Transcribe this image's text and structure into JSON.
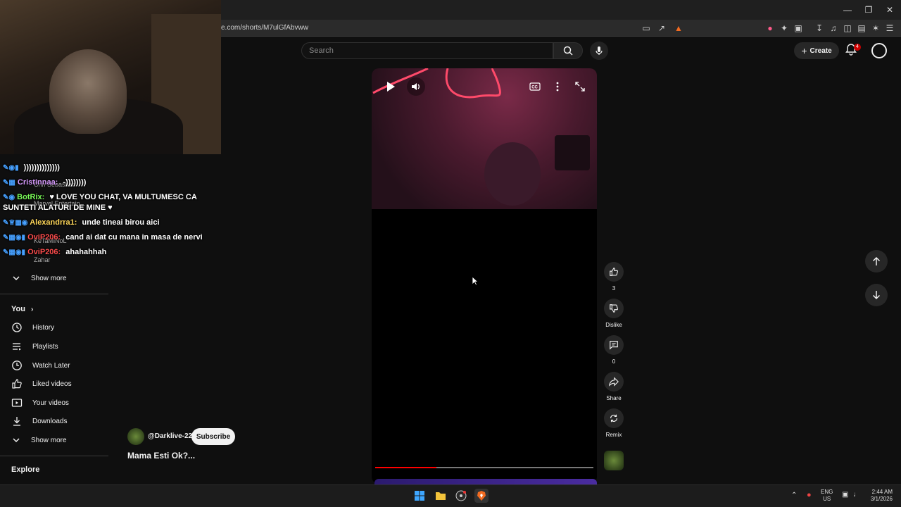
{
  "browser": {
    "url": "e.com/shorts/M7ulGfAbvww"
  },
  "header": {
    "search_placeholder": "Search",
    "create_label": "Create",
    "notification_count": "4"
  },
  "chat": [
    {
      "user": "",
      "message": "))))))))))))))"
    },
    {
      "user": "Cristinnaa:",
      "message": "-))))))))"
    },
    {
      "user": "BotRix:",
      "message": "♥ LOVE YOU CHAT, VA MULTUMESC CA SUNTETI ALATURI DE MINE ♥"
    },
    {
      "user": "Alexandrra1:",
      "message": "unde tineai birou aici"
    },
    {
      "user": "OviP206:",
      "message": "cand ai dat cu mana in masa de nervi"
    },
    {
      "user": "OviP206:",
      "message": "ahahahhah"
    }
  ],
  "sidebar_faded": [
    "Marvel Entertain...",
    "KeTaMiNoL",
    "Zahar"
  ],
  "sidebar": {
    "show_more_1": "Show more",
    "you_label": "You",
    "items": [
      "History",
      "Playlists",
      "Watch Later",
      "Liked videos",
      "Your videos",
      "Downloads"
    ],
    "show_more_2": "Show more",
    "explore_label": "Explore"
  },
  "short": {
    "channel": "@Darklive-22",
    "subscribe_label": "Subscribe",
    "title": "Mama Esti Ok?...",
    "progress": 0.28
  },
  "actions": {
    "like_count": "3",
    "dislike_label": "Dislike",
    "comments_count": "0",
    "share_label": "Share",
    "remix_label": "Remix"
  },
  "taskbar": {
    "lang_line1": "ENG",
    "lang_line2": "US",
    "time": "2:44 AM",
    "date": "3/1/2026"
  }
}
